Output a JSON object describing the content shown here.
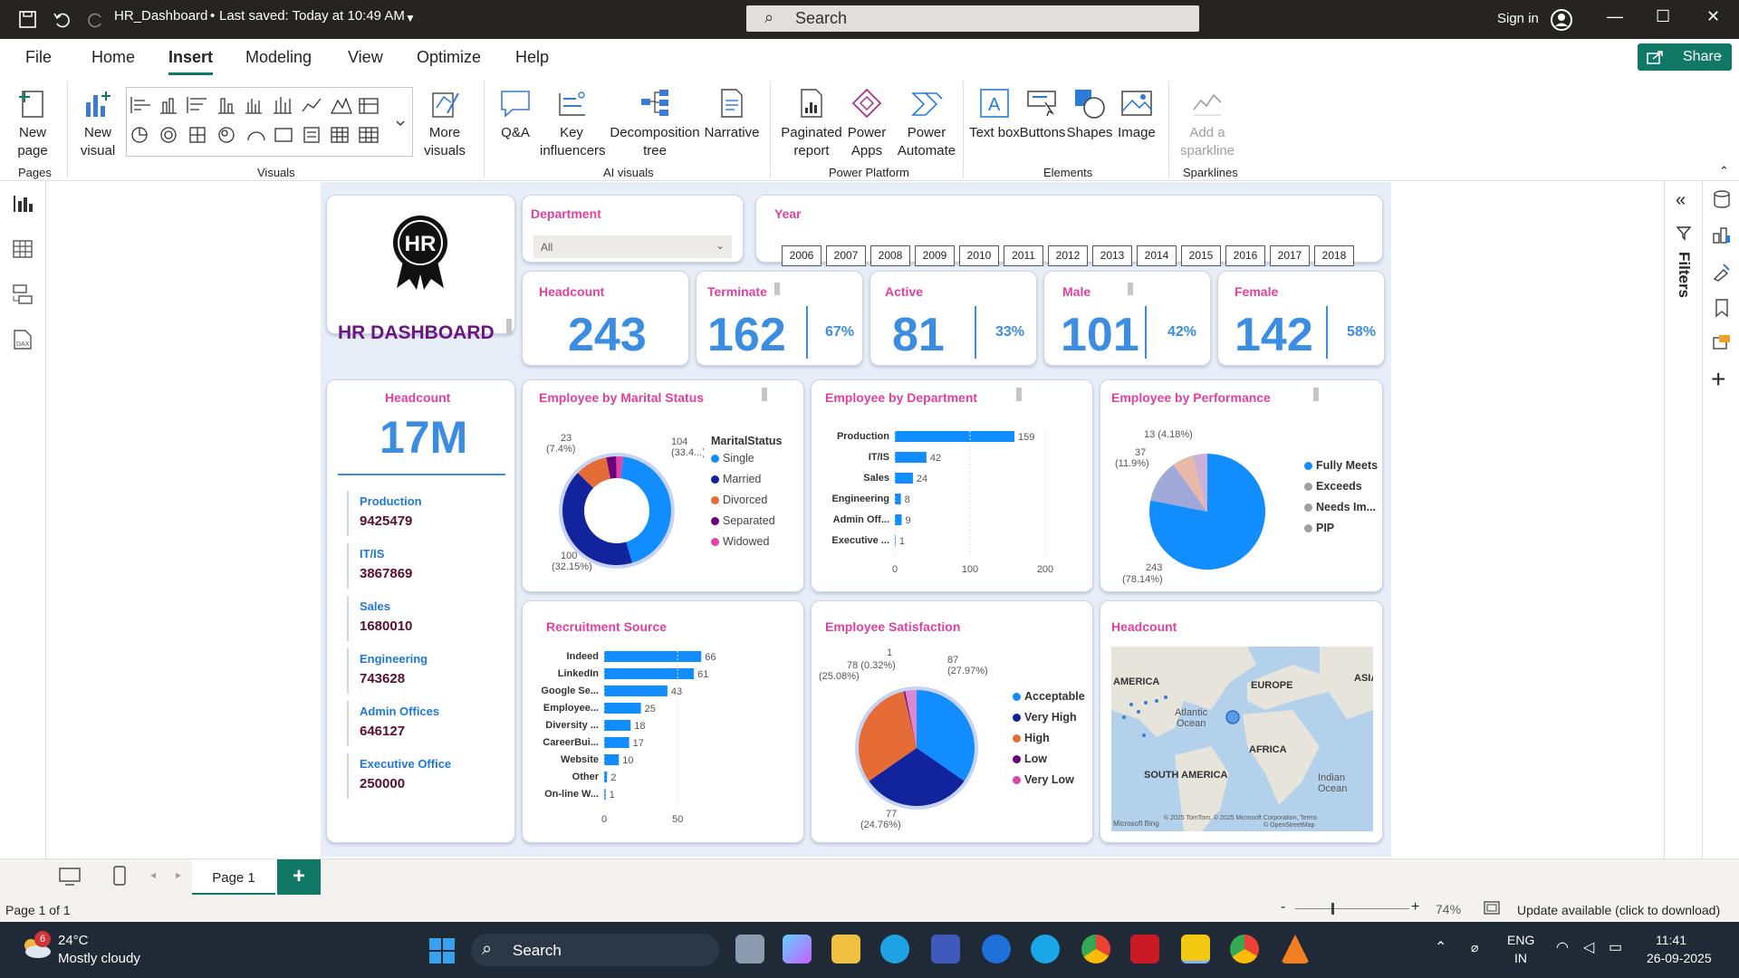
{
  "titlebar": {
    "file_name": "HR_Dashboard",
    "saved": "Last saved: Today at 10:49 AM",
    "search_placeholder": "Search",
    "sign_in": "Sign in"
  },
  "menu": {
    "items": [
      "File",
      "Home",
      "Insert",
      "Modeling",
      "View",
      "Optimize",
      "Help"
    ],
    "active": "Insert",
    "share": "Share"
  },
  "ribbon": {
    "new_page": "New page",
    "pages_group": "Pages",
    "new_visual": "New visual",
    "more_visuals": "More visuals",
    "visuals_group": "Visuals",
    "qa": "Q&A",
    "key_influencers": "Key influencers",
    "decomposition_tree": "Decomposition tree",
    "narrative": "Narrative",
    "ai_group": "AI visuals",
    "paginated_report": "Paginated report",
    "power_apps": "Power Apps",
    "power_automate": "Power Automate",
    "platform_group": "Power Platform",
    "text_box": "Text box",
    "buttons": "Buttons",
    "shapes": "Shapes",
    "image": "Image",
    "elements_group": "Elements",
    "add_sparkline": "Add a sparkline",
    "sparklines_group": "Sparklines"
  },
  "report": {
    "logo_text": "HR",
    "dashboard_title": "HR DASHBOARD",
    "department_slicer": {
      "title": "Department",
      "value": "All"
    },
    "year_slicer": {
      "title": "Year",
      "years": [
        "2006",
        "2007",
        "2008",
        "2009",
        "2010",
        "2011",
        "2012",
        "2013",
        "2014",
        "2015",
        "2016",
        "2017",
        "2018"
      ]
    },
    "kpis": [
      {
        "title": "Headcount",
        "value": "243",
        "pct": ""
      },
      {
        "title": "Terminate",
        "value": "162",
        "pct": "67%"
      },
      {
        "title": "Active",
        "value": "81",
        "pct": "33%"
      },
      {
        "title": "Male",
        "value": "101",
        "pct": "42%"
      },
      {
        "title": "Female",
        "value": "142",
        "pct": "58%"
      }
    ],
    "headcount_card": {
      "title": "Headcount",
      "value": "17M",
      "items": [
        {
          "label": "Production",
          "value": "9425479"
        },
        {
          "label": "IT/IS",
          "value": "3867869"
        },
        {
          "label": "Sales",
          "value": "1680010"
        },
        {
          "label": "Engineering",
          "value": "743628"
        },
        {
          "label": "Admin Offices",
          "value": "646127"
        },
        {
          "label": "Executive Office",
          "value": "250000"
        }
      ]
    },
    "marital": {
      "title": "Employee by Marital Status",
      "legend_title": "MaritalStatus",
      "legend": [
        "Single",
        "Married",
        "Divorced",
        "Separated",
        "Widowed"
      ],
      "labels": [
        "104",
        "(33.4...)",
        "100",
        "(32.15%)",
        "23",
        "(7.4%)"
      ]
    },
    "department_chart": {
      "title": "Employee by Department",
      "axis_ticks": [
        "0",
        "100",
        "200"
      ]
    },
    "performance": {
      "title": "Employee by Performance",
      "legend": [
        "Fully Meets",
        "Exceeds",
        "Needs Im...",
        "PIP"
      ],
      "labels": [
        "13 (4.18%)",
        "37",
        "(11.9%)",
        "243",
        "(78.14%)"
      ]
    },
    "recruitment_chart": {
      "title": "Recruitment Source",
      "axis_ticks": [
        "0",
        "50"
      ]
    },
    "satisfaction": {
      "title": "Employee Satisfaction",
      "legend": [
        "Acceptable",
        "Very High",
        "High",
        "Low",
        "Very Low"
      ],
      "labels": [
        "1",
        "87",
        "(27.97%)",
        "78 (0.32%)",
        "(25.08%)",
        "77",
        "(24.76%)"
      ]
    },
    "map": {
      "title": "Headcount",
      "labels": [
        "AMERICA",
        "EUROPE",
        "ASIA",
        "Atlantic",
        "Ocean",
        "AFRICA",
        "SOUTH AMERICA",
        "Indian",
        "Ocean"
      ],
      "attribution": "© 2025 TomTom, © 2025 Microsoft Corporation, Terms",
      "attribution2": "© OpenStreetMap",
      "brand": "Microsoft Bing"
    }
  },
  "chart_data": [
    {
      "type": "bar",
      "title": "Employee by Department",
      "categories": [
        "Production",
        "IT/IS",
        "Sales",
        "Engineering",
        "Admin Off...",
        "Executive ..."
      ],
      "values": [
        159,
        42,
        24,
        8,
        9,
        1
      ],
      "xlim": [
        0,
        200
      ],
      "ticks": [
        0,
        100,
        200
      ]
    },
    {
      "type": "bar",
      "title": "Recruitment Source",
      "categories": [
        "Indeed",
        "LinkedIn",
        "Google Se...",
        "Employee...",
        "Diversity ...",
        "CareerBui...",
        "Website",
        "Other",
        "On-line W..."
      ],
      "values": [
        66,
        61,
        43,
        25,
        18,
        17,
        10,
        2,
        1
      ],
      "xlim": [
        0,
        80
      ],
      "ticks": [
        0,
        50
      ]
    },
    {
      "type": "pie",
      "title": "Employee by Marital Status",
      "donut": true,
      "categories": [
        "Single",
        "Married",
        "Divorced",
        "Separated",
        "Widowed"
      ],
      "values": [
        104,
        100,
        23,
        7,
        5
      ],
      "colors": [
        "#118dff",
        "#12239e",
        "#e66c37",
        "#6b007b",
        "#e044a7"
      ]
    },
    {
      "type": "pie",
      "title": "Employee by Performance",
      "categories": [
        "Fully Meets",
        "Exceeds",
        "Needs Im...",
        "PIP"
      ],
      "values": [
        243,
        37,
        18,
        13
      ],
      "colors": [
        "#118dff",
        "#a0a8d8",
        "#e8b8a8",
        "#c8b0d8"
      ]
    },
    {
      "type": "pie",
      "title": "Employee Satisfaction",
      "categories": [
        "Acceptable",
        "Very High",
        "High",
        "Low",
        "Very Low"
      ],
      "values": [
        87,
        77,
        78,
        1,
        8
      ],
      "colors": [
        "#118dff",
        "#12239e",
        "#e66c37",
        "#6b007b",
        "#d88ad0"
      ]
    }
  ],
  "pagetabs": {
    "page": "Page 1"
  },
  "statusbar": {
    "page_info": "Page 1 of 1",
    "zoom": "74%",
    "update": "Update available (click to download)"
  },
  "taskbar": {
    "weather_temp": "24°C",
    "weather_desc": "Mostly cloudy",
    "weather_badge": "6",
    "search": "Search",
    "lang1": "ENG",
    "lang2": "IN",
    "time": "11:41",
    "date": "26-09-2025"
  }
}
